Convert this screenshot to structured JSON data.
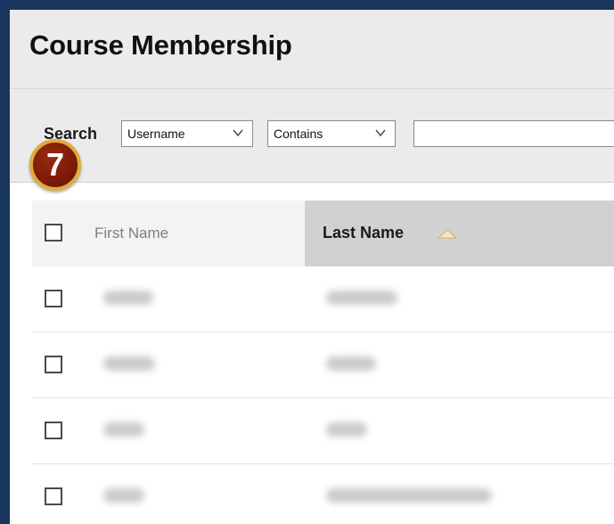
{
  "page": {
    "title": "Course Membership"
  },
  "search": {
    "label": "Search",
    "field_select": "Username",
    "operator_select": "Contains",
    "query": ""
  },
  "annotation": {
    "step": "7"
  },
  "table": {
    "columns": [
      {
        "label": "First Name"
      },
      {
        "label": "Last Name",
        "sort": "ascending"
      }
    ],
    "rows": [
      {
        "first_name_redacted": true,
        "last_name_redacted": true
      },
      {
        "first_name_redacted": true,
        "last_name_redacted": true
      },
      {
        "first_name_redacted": true,
        "last_name_redacted": true
      },
      {
        "first_name_redacted": true,
        "last_name_redacted": true
      }
    ]
  },
  "colors": {
    "frame_border": "#18355e",
    "header_bg": "#ebebeb",
    "sorted_column_bg": "#d1d1d1",
    "badge_fill": "#7b1a06",
    "badge_ring": "#e0a93a"
  }
}
